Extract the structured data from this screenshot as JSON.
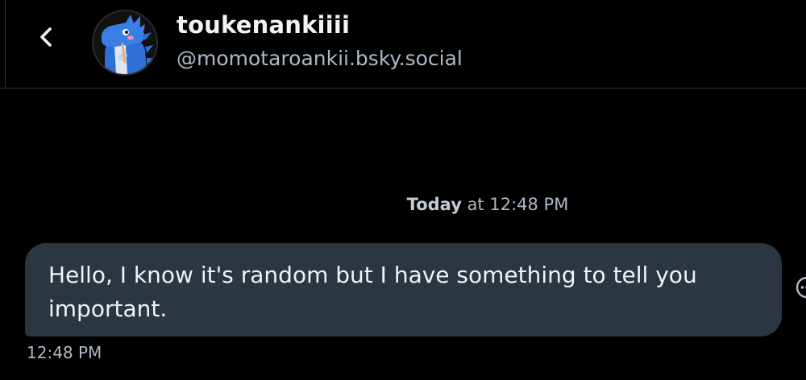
{
  "header": {
    "back_icon": "chevron-left-icon",
    "display_name": "toukenankiiii",
    "handle": "@momotaroankii.bsky.social",
    "avatar": "blue-dragon-avatar"
  },
  "conversation": {
    "date_divider": {
      "day": "Today",
      "rest": " at 12:48 PM"
    },
    "messages": [
      {
        "text": "Hello, I know it's random but I have something to tell you important.",
        "time": "12:48 PM"
      }
    ],
    "more_icon": "more-options-icon"
  },
  "colors": {
    "background": "#000000",
    "bubble": "#2c3640",
    "primary_text": "#f1f3f5",
    "secondary_text": "#aeb9c6",
    "divider": "#2b3440",
    "avatar_accent": "#2f6fd6"
  }
}
